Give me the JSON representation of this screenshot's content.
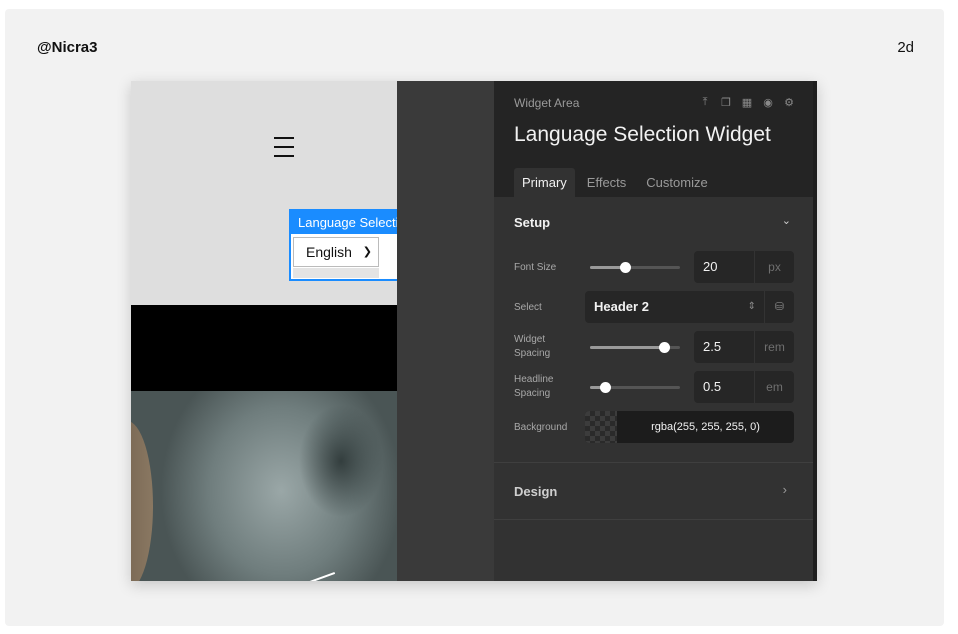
{
  "post": {
    "username": "@Nicra3",
    "age": "2d"
  },
  "preview": {
    "widget_label": "Language Selecti",
    "select_value": "English"
  },
  "panel": {
    "breadcrumb": "Widget Area",
    "icons": [
      "upload-icon",
      "copy-icon",
      "trash-icon",
      "eye-icon",
      "gear-icon"
    ],
    "title": "Language Selection Widget",
    "tabs": [
      {
        "label": "Primary",
        "active": true
      },
      {
        "label": "Effects",
        "active": false
      },
      {
        "label": "Customize",
        "active": false
      }
    ],
    "setup": {
      "title": "Setup",
      "font_size": {
        "label": "Font Size",
        "value": "20",
        "unit": "px",
        "slider": 0.38
      },
      "select": {
        "label": "Select",
        "value": "Header 2"
      },
      "widget_spacing": {
        "label1": "Widget",
        "label2": "Spacing",
        "value": "2.5",
        "unit": "rem",
        "slider": 0.83
      },
      "headline_spacing": {
        "label1": "Headline",
        "label2": "Spacing",
        "value": "0.5",
        "unit": "em",
        "slider": 0.16
      },
      "background": {
        "label": "Background",
        "value": "rgba(255, 255, 255, 0)"
      }
    },
    "design": {
      "title": "Design"
    }
  },
  "colors": {
    "accent": "#1a8cff",
    "panel_bg": "#323232",
    "panel_head": "#242424"
  }
}
